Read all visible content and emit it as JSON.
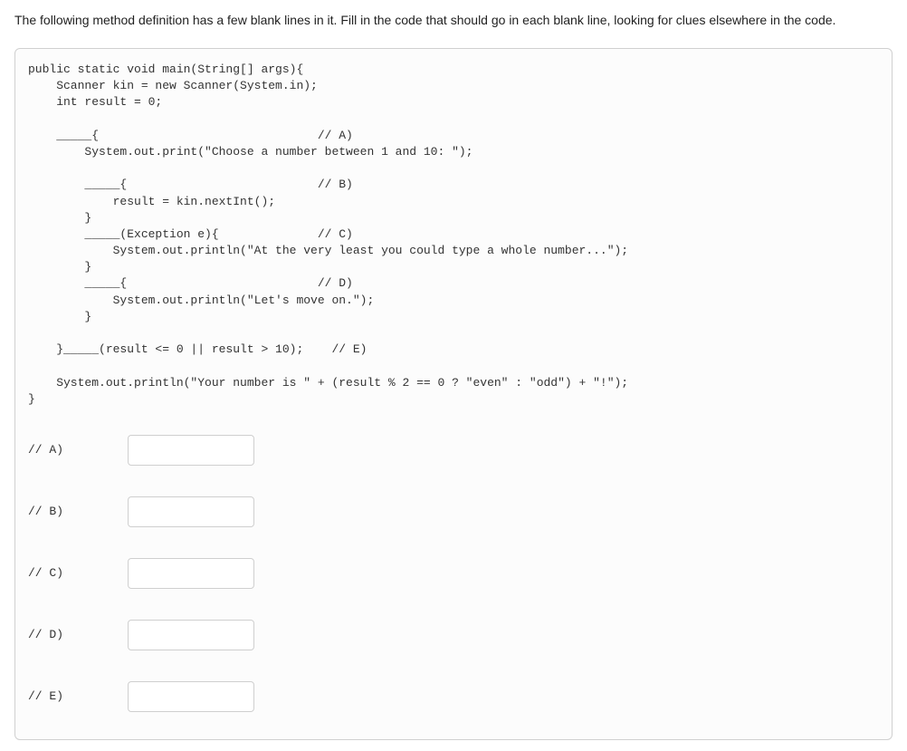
{
  "question": "The following method definition has a few blank lines in it. Fill in the code that should go in each blank line, looking for clues elsewhere in the code.",
  "code": "public static void main(String[] args){\n    Scanner kin = new Scanner(System.in);\n    int result = 0;\n\n    _____{                               // A)\n        System.out.print(\"Choose a number between 1 and 10: \");\n\n        _____{                           // B)\n            result = kin.nextInt();\n        }\n        _____(Exception e){              // C)\n            System.out.println(\"At the very least you could type a whole number...\");\n        }\n        _____{                           // D)\n            System.out.println(\"Let's move on.\");\n        }\n\n    }_____(result <= 0 || result > 10);    // E)\n\n    System.out.println(\"Your number is \" + (result % 2 == 0 ? \"even\" : \"odd\") + \"!\");\n}",
  "answers": [
    {
      "label": "// A)",
      "value": ""
    },
    {
      "label": "// B)",
      "value": ""
    },
    {
      "label": "// C)",
      "value": ""
    },
    {
      "label": "// D)",
      "value": ""
    },
    {
      "label": "// E)",
      "value": ""
    }
  ]
}
